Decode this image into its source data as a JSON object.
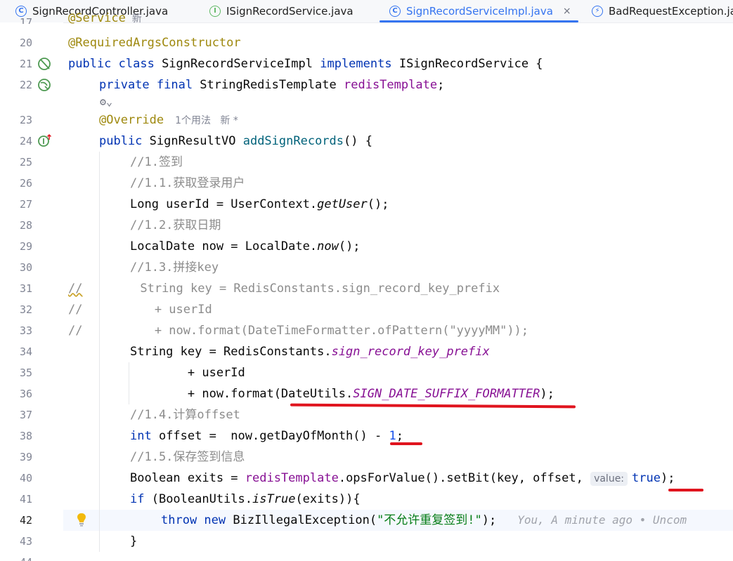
{
  "tabs": [
    {
      "label": "SignRecordController.java",
      "icon": "class-icon",
      "icon_char": "C"
    },
    {
      "label": "ISignRecordService.java",
      "icon": "interface-icon",
      "icon_char": "I"
    },
    {
      "label": "SignRecordServiceImpl.java",
      "icon": "class-icon",
      "icon_char": "C",
      "active": true,
      "close": "×"
    },
    {
      "label": "BadRequestException.ja",
      "icon": "exception-icon",
      "icon_char": "⚡"
    }
  ],
  "gutter": {
    "line_numbers": [
      "17",
      "20",
      "21",
      "22",
      "23",
      "24",
      "25",
      "26",
      "27",
      "28",
      "29",
      "30",
      "31",
      "32",
      "33",
      "34",
      "35",
      "36",
      "37",
      "38",
      "39",
      "40",
      "41",
      "42",
      "43",
      "44"
    ],
    "current_line": "42"
  },
  "code": {
    "l19a": "@Service",
    "l19b": "  新",
    "l20": "@RequiredArgsConstructor",
    "l21_kw1": "public class ",
    "l21_name": "SignRecordServiceImpl ",
    "l21_kw2": "implements ",
    "l21_iface": "ISignRecordService {",
    "l22_kw": "private final ",
    "l22_type": "StringRedisTemplate ",
    "l22_field": "redisTemplate",
    "l22_end": ";",
    "ai_icon": "⚙",
    "ai_chev": "⌄",
    "l23_ann": "@Override",
    "l23_hint": "1个用法   新 *",
    "l24_kw": "public ",
    "l24_type": "SignResultVO ",
    "l24_fn": "addSignRecords",
    "l24_end": "() {",
    "l25": "//1.签到",
    "l26": "//1.1.获取登录用户",
    "l27a": "Long userId = UserContext.",
    "l27b": "getUser",
    "l27c": "();",
    "l28": "//1.2.获取日期",
    "l29a": "LocalDate now = LocalDate.",
    "l29b": "now",
    "l29c": "();",
    "l30": "//1.3.拼接key",
    "l31a": "//",
    "l31b": "        String key = RedisConstants.sign_record_key_prefix",
    "l32": "//          + userId",
    "l33": "//          + now.format(DateTimeFormatter.ofPattern(\"yyyyMM\"));",
    "l34a": "String key = RedisConstants.",
    "l34b": "sign_record_key_prefix",
    "l35": "        + userId",
    "l36a": "        + now.format(DateUtils.",
    "l36b": "SIGN_DATE_SUFFIX_FORMATTER",
    "l36c": ");",
    "l37": "//1.4.计算offset",
    "l38_kw": "int ",
    "l38a": "offset =  now.getDayOfMonth() - ",
    "l38_num": "1",
    "l38c": ";",
    "l39": "//1.5.保存签到信息",
    "l40a": "Boolean exits = ",
    "l40_field": "redisTemplate",
    "l40b": ".opsForValue().setBit(key, offset, ",
    "l40_inlay": "value:",
    "l40_kw": "true",
    "l40c": ");",
    "l41_kw": "if ",
    "l41a": "(BooleanUtils.",
    "l41b": "isTrue",
    "l41c": "(exits)){",
    "l42_kw": "throw new ",
    "l42a": "BizIllegalException(",
    "l42_str": "\"不允许重复签到!\"",
    "l42c": ");",
    "l42_blame": "You, A minute ago • Uncom",
    "l43": "}"
  },
  "colors": {
    "accent": "#3574f0",
    "annotation_red": "#e0141e",
    "keyword": "#0033b3",
    "comment": "#8c8c8c",
    "string": "#067d17",
    "number": "#1750eb",
    "field": "#871094",
    "annotation": "#9e880d"
  }
}
